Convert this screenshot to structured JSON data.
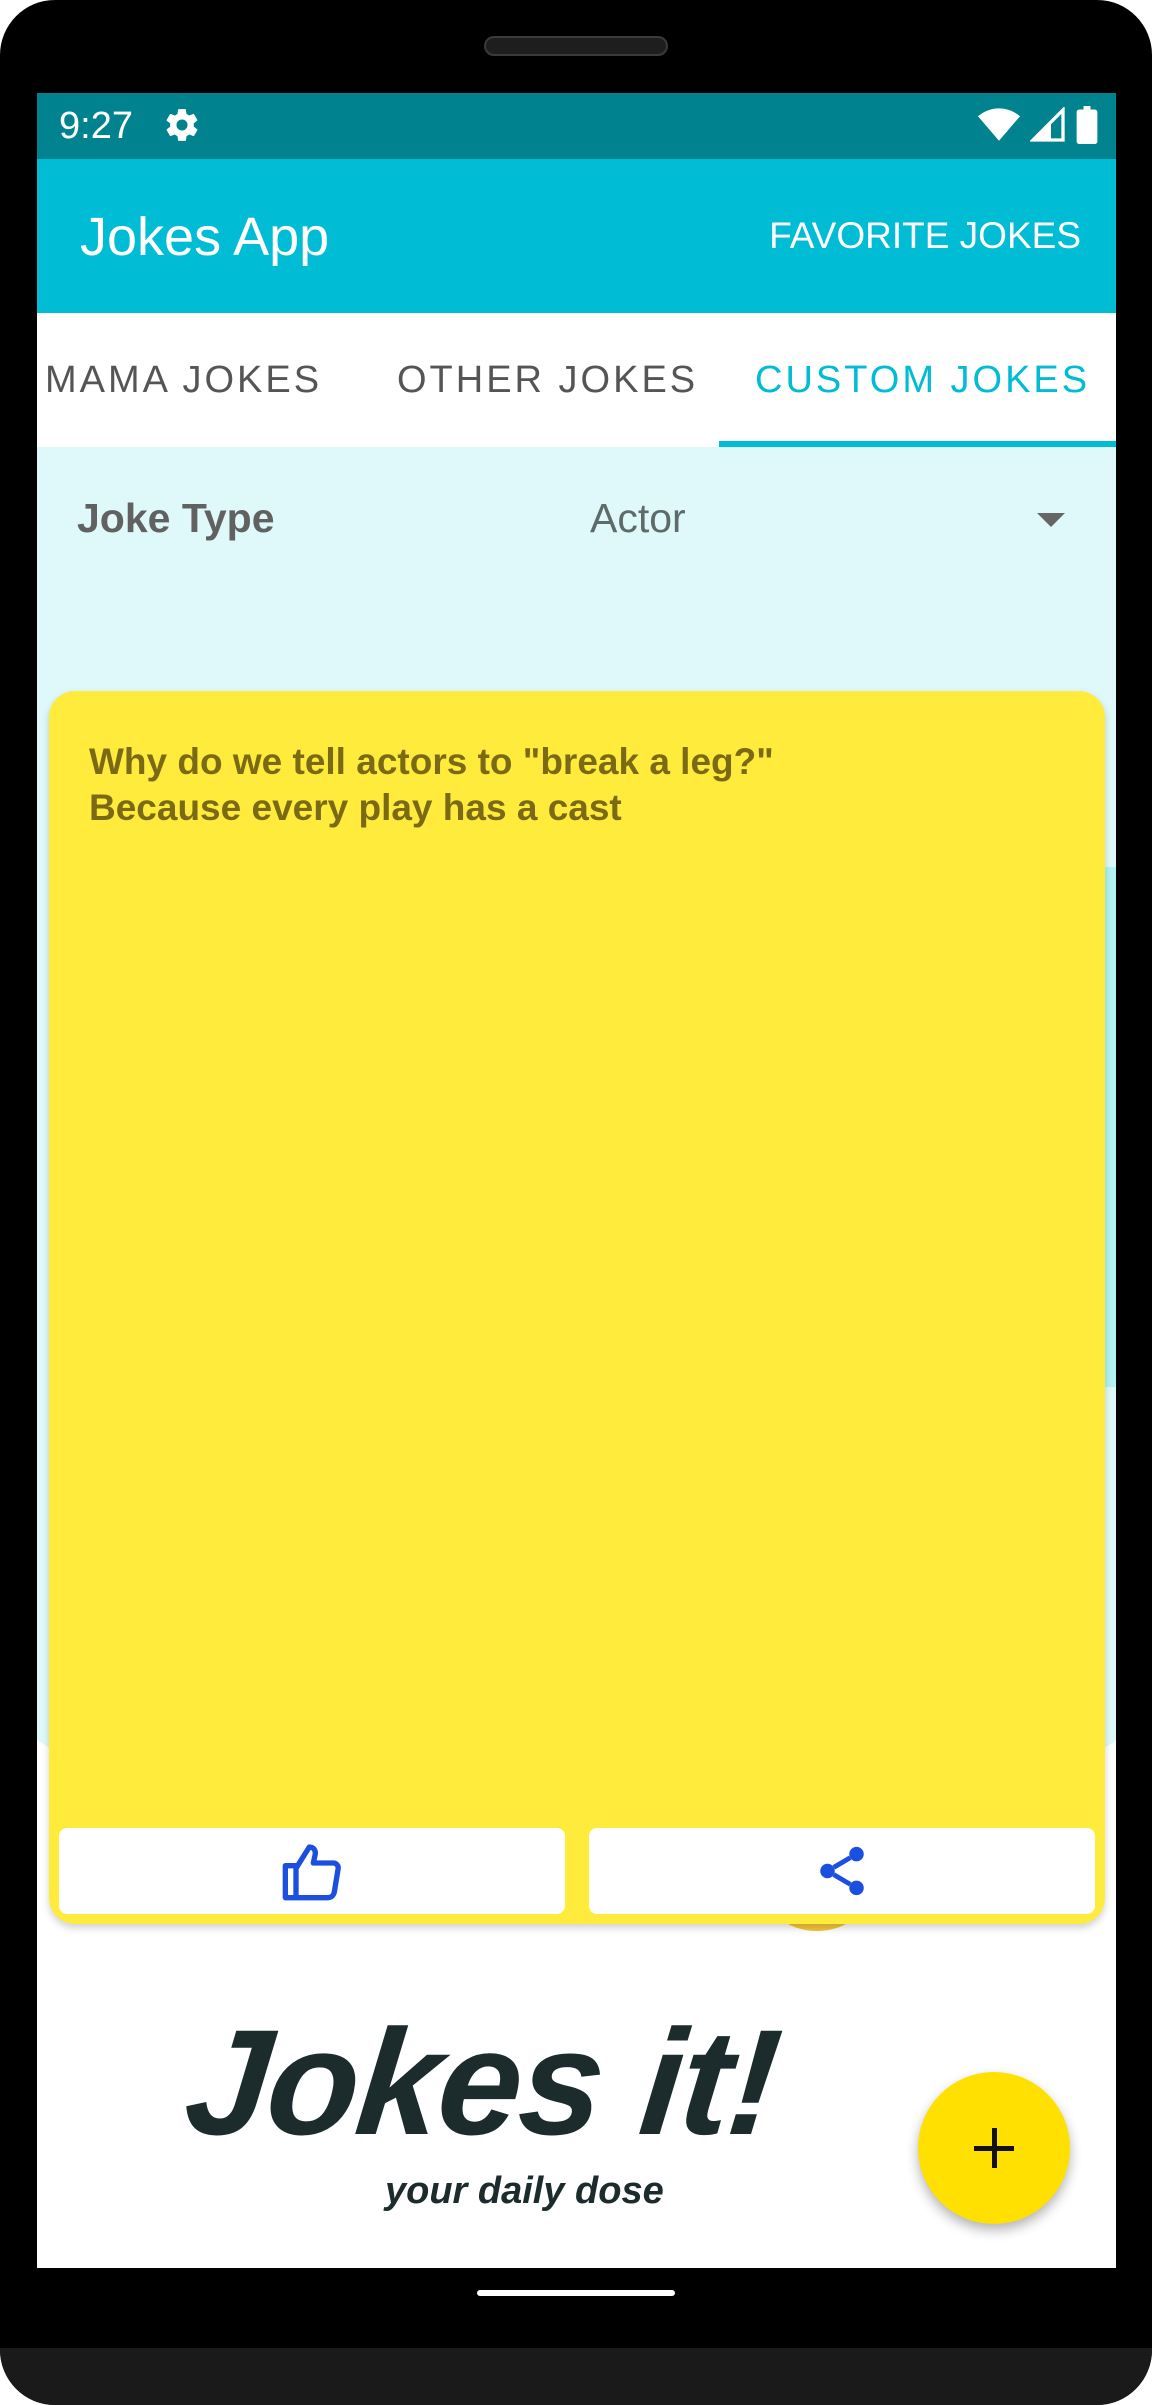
{
  "status_bar": {
    "time": "9:27"
  },
  "app_bar": {
    "title": "Jokes App",
    "favorite_button": "FAVORITE JOKES"
  },
  "tabs": [
    {
      "label": "MAMA JOKES",
      "active": false
    },
    {
      "label": "OTHER JOKES",
      "active": false
    },
    {
      "label": "CUSTOM JOKES",
      "active": true
    }
  ],
  "joke_type": {
    "label": "Joke Type",
    "selected": "Actor"
  },
  "joke": {
    "text": "Why do we tell  actors to \"break a leg?\"\nBecause every play has a cast"
  },
  "card_actions": [
    {
      "icon": "thumbs-up-icon"
    },
    {
      "icon": "share-icon"
    }
  ],
  "logo": {
    "title": "Jokes it!",
    "tagline": "your daily dose"
  },
  "fab": {
    "icon": "plus-icon"
  },
  "colors": {
    "status_bar": "#00838f",
    "accent": "#00bcd4",
    "card": "#ffeb3b",
    "action_icon": "#1a4fe0",
    "fab": "#ffe000"
  }
}
